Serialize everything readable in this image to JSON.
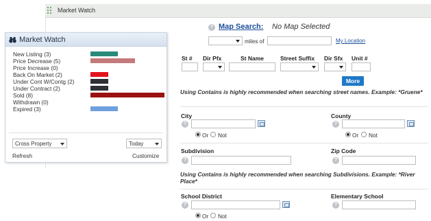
{
  "topbar": {
    "title": "Market Watch"
  },
  "widget": {
    "title": "Market Watch",
    "items": [
      {
        "label": "New Listing (3)",
        "color": "#2a8a7a",
        "count": 3
      },
      {
        "label": "Price Decrease (5)",
        "color": "#c47a7a",
        "count": 5
      },
      {
        "label": "Price Increase (0)",
        "color": "",
        "count": 0
      },
      {
        "label": "Back On Market (2)",
        "color": "#e3141c",
        "count": 2
      },
      {
        "label": "Under Cont W/Contg (2)",
        "color": "#2f2f35",
        "count": 2
      },
      {
        "label": "Under Contract (2)",
        "color": "#2f2f35",
        "count": 2
      },
      {
        "label": "Sold (8)",
        "color": "#9b1010",
        "count": 8
      },
      {
        "label": "Withdrawn (0)",
        "color": "",
        "count": 0
      },
      {
        "label": "Expired (3)",
        "color": "#6ea0dd",
        "count": 3
      }
    ],
    "property_select": "Cross Property",
    "period_select": "Today",
    "refresh": "Refresh",
    "customize": "Customize"
  },
  "search": {
    "map_search_link": "Map Search:",
    "map_status": "No Map Selected",
    "miles_of": "miles of",
    "my_location": "My Location",
    "street_labels": {
      "st_num": "St #",
      "dir_pfx": "Dir Pfx",
      "st_name": "St Name",
      "street_suffix": "Street Suffix",
      "dir_sfx": "Dir Sfx",
      "unit_num": "Unit #"
    },
    "more_button": "More",
    "street_note": "Using Contains is highly recommended when searching street names. Example: *Gruene*",
    "city_label": "City",
    "county_label": "County",
    "or_label": "Or",
    "not_label": "Not",
    "subdivision_label": "Subdivision",
    "zip_label": "Zip Code",
    "subdivision_note": "Using Contains is highly recommended when searching Subdivisions. Example: *River Place*",
    "school_district_label": "School District",
    "elementary_label": "Elementary School"
  }
}
